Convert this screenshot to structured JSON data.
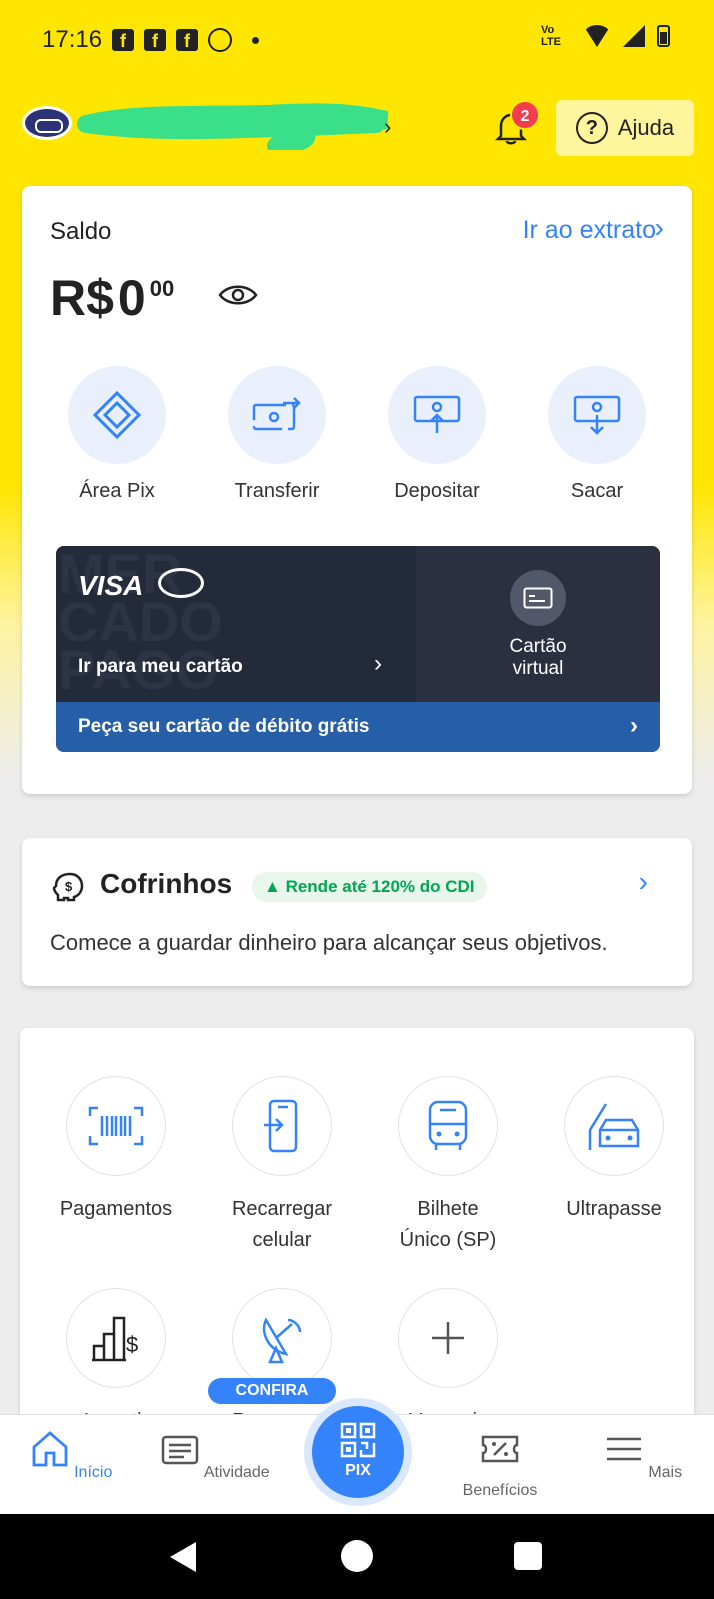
{
  "status_bar": {
    "time": "17:16",
    "network": "Vo LTE"
  },
  "header": {
    "account_name": "",
    "notification_count": "2",
    "help_label": "Ajuda"
  },
  "balance_card": {
    "title": "Saldo",
    "statement_link": "Ir ao extrato",
    "currency": "R$",
    "amount_int": "0",
    "amount_cents": "00",
    "actions": [
      {
        "label": "Área Pix",
        "icon": "pix-icon"
      },
      {
        "label": "Transferir",
        "icon": "transfer-icon"
      },
      {
        "label": "Depositar",
        "icon": "deposit-icon"
      },
      {
        "label": "Sacar",
        "icon": "withdraw-icon"
      }
    ],
    "debit_card": {
      "brand": "VISA",
      "watermark": "MER CADO PAGO",
      "go_to_card": "Ir para meu cartão",
      "virtual_label": "Cartão virtual",
      "request_free": "Peça seu cartão de débito grátis"
    }
  },
  "savings_card": {
    "title": "Cofrinhos",
    "tag": "Rende até 120% do CDI",
    "description": "Comece a guardar dinheiro para alcançar seus objetivos."
  },
  "services": {
    "items": [
      {
        "label": "Pagamentos",
        "icon": "barcode-icon"
      },
      {
        "label": "Recarregar celular",
        "icon": "phone-recharge-icon"
      },
      {
        "label": "Bilhete Único (SP)",
        "icon": "bus-icon"
      },
      {
        "label": "Ultrapasse",
        "icon": "car-toll-icon"
      },
      {
        "label": "Investir",
        "icon": "invest-chart-icon"
      },
      {
        "label": "Recarregar",
        "icon": "satellite-dish-icon"
      },
      {
        "label": "Ver mais",
        "icon": "plus-icon"
      }
    ],
    "promo_badge": "CONFIRA"
  },
  "bottom_nav": {
    "items": [
      {
        "label": "Início",
        "icon": "home-icon",
        "active": true
      },
      {
        "label": "Atividade",
        "icon": "activity-icon",
        "active": false
      },
      {
        "label": "PIX",
        "icon": "qr-code-icon",
        "active": false
      },
      {
        "label": "Benefícios",
        "icon": "ticket-percent-icon",
        "active": false
      },
      {
        "label": "Mais",
        "icon": "menu-icon",
        "active": false
      }
    ]
  },
  "colors": {
    "brand_yellow": "#ffe600",
    "accent_blue": "#3483fa",
    "badge_red": "#f23d4f",
    "card_dark": "#232a39",
    "card_blue": "#265fa8",
    "success_green": "#00a650"
  }
}
